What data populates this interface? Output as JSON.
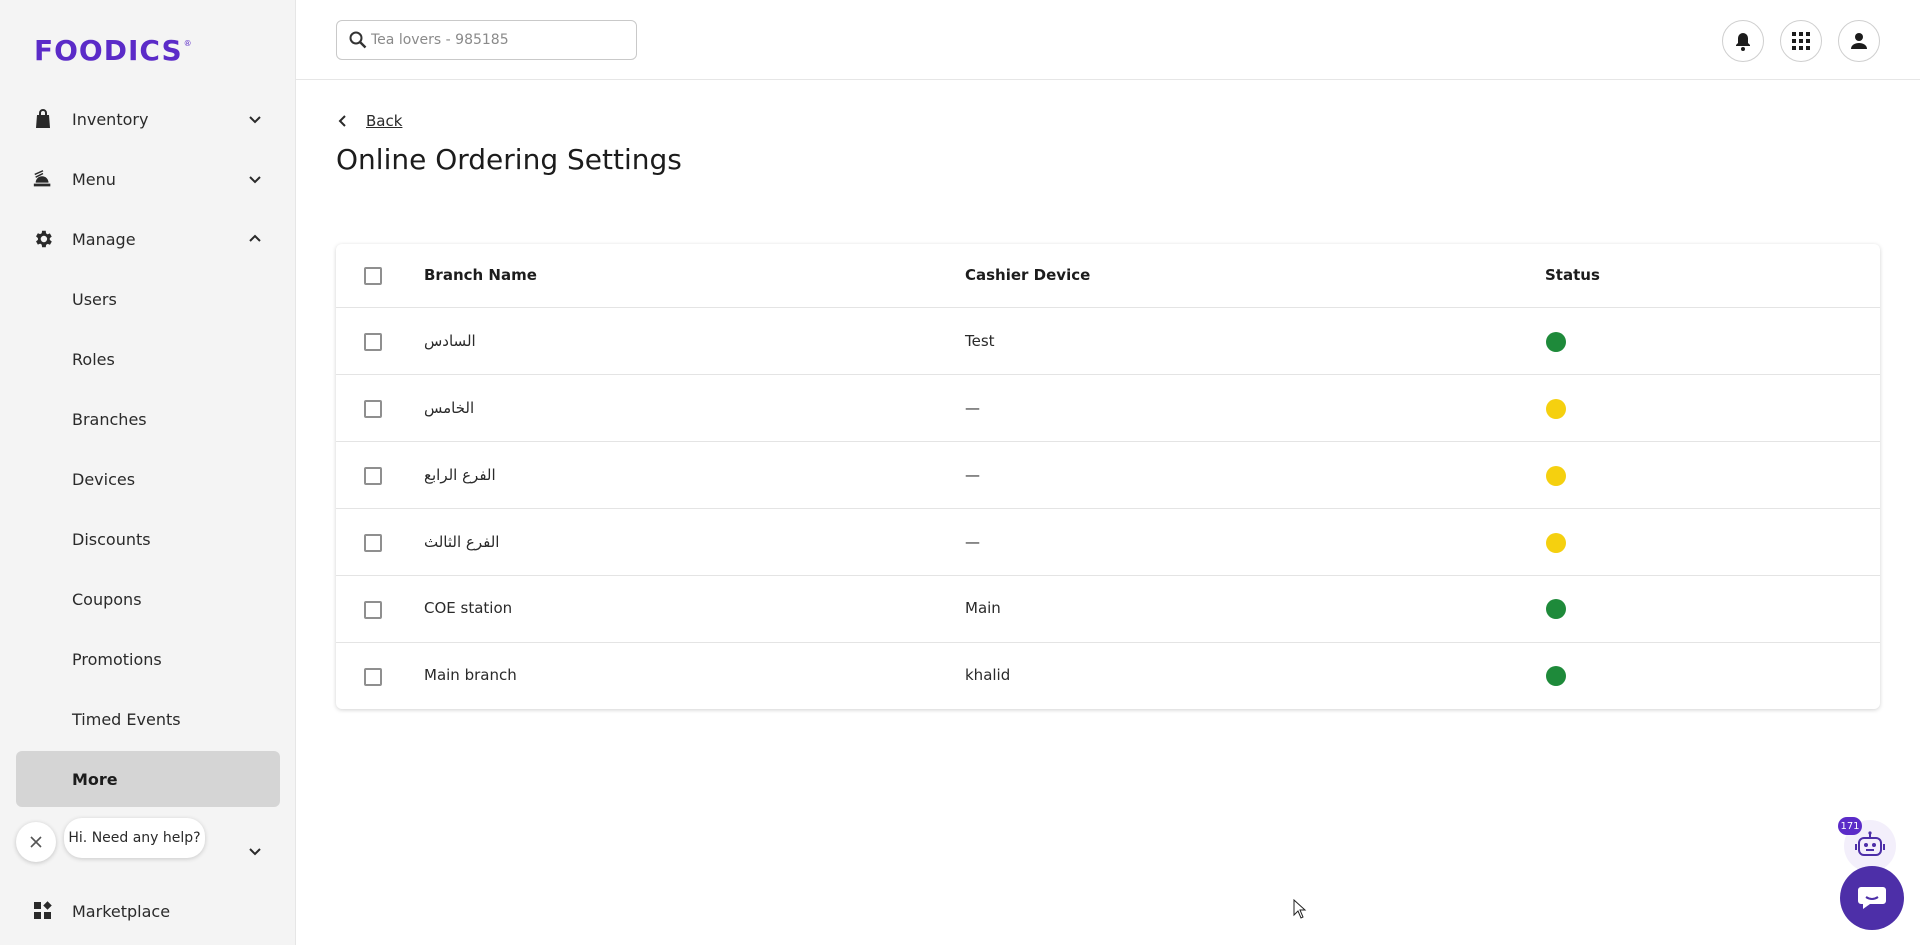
{
  "brand": {
    "name": "FOODICS",
    "reg": "®",
    "accent": "#5b2bc8"
  },
  "search": {
    "placeholder": "Tea lovers - 985185"
  },
  "sidebar": {
    "groups": [
      {
        "label": "Inventory",
        "icon": "shopping-bag-icon",
        "expanded": false
      },
      {
        "label": "Menu",
        "icon": "food-tray-icon",
        "expanded": false
      },
      {
        "label": "Manage",
        "icon": "gear-icon",
        "expanded": true
      }
    ],
    "manage_items": [
      {
        "label": "Users"
      },
      {
        "label": "Roles"
      },
      {
        "label": "Branches"
      },
      {
        "label": "Devices"
      },
      {
        "label": "Discounts"
      },
      {
        "label": "Coupons"
      },
      {
        "label": "Promotions"
      },
      {
        "label": "Timed Events"
      },
      {
        "label": "More",
        "active": true
      }
    ],
    "bottom_items": [
      {
        "label": "Marketplace",
        "icon": "apps-icon"
      }
    ]
  },
  "topbar": {
    "icons": [
      "bell-icon",
      "grid-apps-icon",
      "user-icon"
    ]
  },
  "main": {
    "back_label": "Back",
    "title": "Online Ordering Settings",
    "table": {
      "columns": [
        "Branch Name",
        "Cashier Device",
        "Status"
      ],
      "rows": [
        {
          "branch": "السادس",
          "device": "Test",
          "status": "active"
        },
        {
          "branch": "الخامس",
          "device": "—",
          "status": "pending"
        },
        {
          "branch": "الفرع الرابع",
          "device": "—",
          "status": "pending"
        },
        {
          "branch": "الفرع الثالث",
          "device": "—",
          "status": "pending"
        },
        {
          "branch": "COE station",
          "device": "Main",
          "status": "active"
        },
        {
          "branch": "Main branch",
          "device": "khalid",
          "status": "active"
        }
      ]
    },
    "status_colors": {
      "active": "#1e8a3a",
      "pending": "#f5d00f"
    }
  },
  "help": {
    "bubble_text": "Hi. Need any help?",
    "badge": "171"
  }
}
